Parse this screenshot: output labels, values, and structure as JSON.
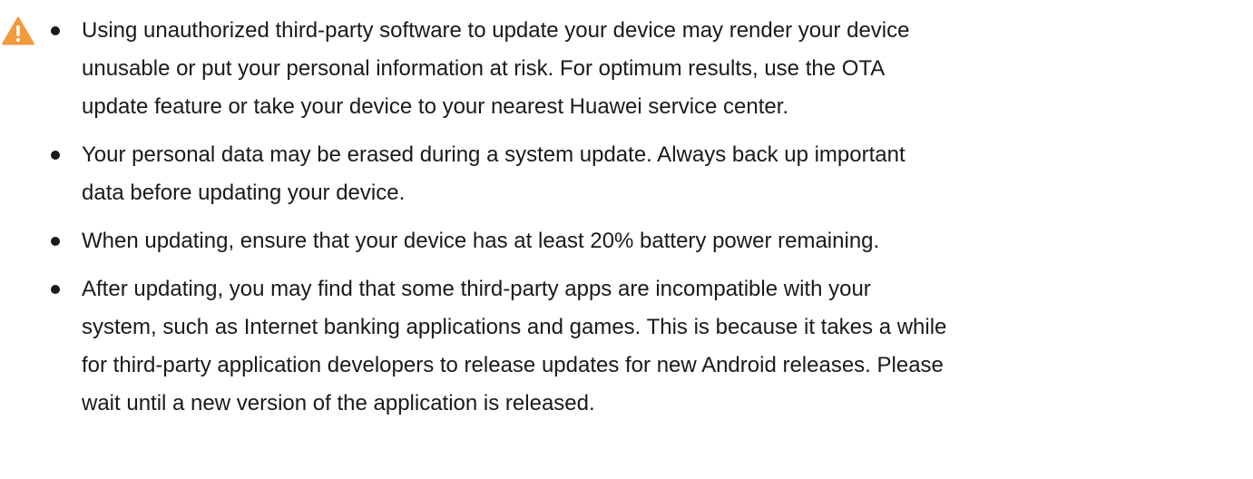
{
  "icon": {
    "name": "warning-icon",
    "triangle_color": "#F39A3D",
    "mark_color": "#ffffff"
  },
  "notes": [
    {
      "lines": [
        "Using unauthorized third-party software to update your device may render your device",
        "unusable or put your personal information at risk. For optimum results, use the OTA",
        "update feature or take your device to your nearest Huawei service center."
      ]
    },
    {
      "lines": [
        "Your personal data may be erased during a system update. Always back up important",
        "data before updating your device."
      ]
    },
    {
      "lines": [
        "When updating, ensure that your device has at least 20% battery power remaining."
      ]
    },
    {
      "lines": [
        "After updating, you may find that some third-party apps are incompatible with your",
        "system, such as Internet banking applications and games. This is because it takes a while",
        "for third-party application developers to release updates for new Android releases. Please",
        "wait until a new version of the application is released."
      ]
    }
  ]
}
